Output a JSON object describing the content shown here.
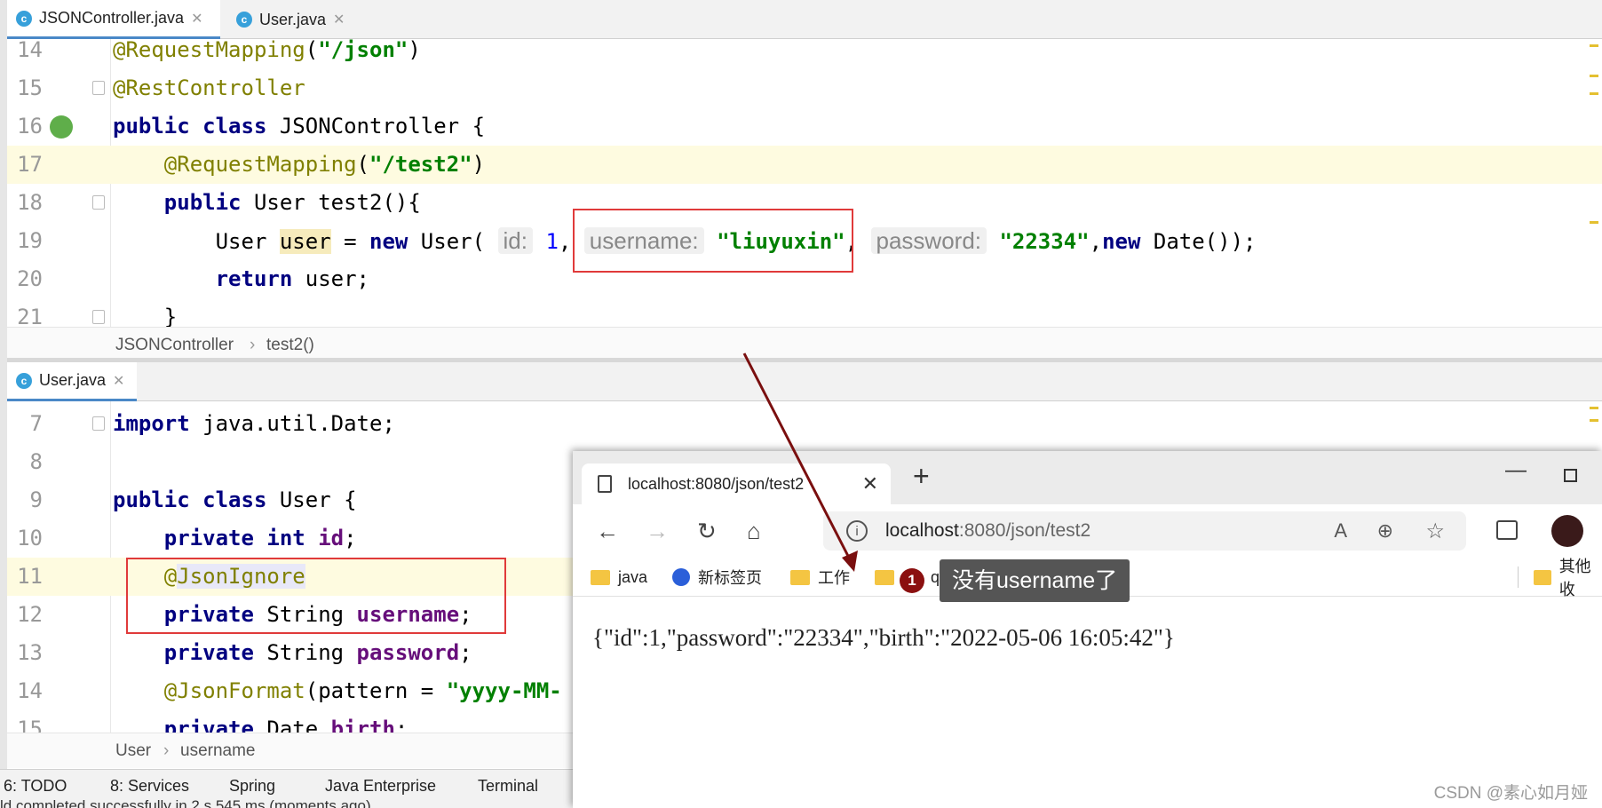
{
  "top_tabs": [
    {
      "label": "JSONController.java"
    },
    {
      "label": "User.java"
    }
  ],
  "editor_top": {
    "lines": [
      {
        "num": "14",
        "text": "@RequestMapping(\"/json\")"
      },
      {
        "num": "15",
        "text": "@RestController"
      },
      {
        "num": "16",
        "text": "public class JSONController {"
      },
      {
        "num": "17",
        "text": "    @RequestMapping(\"/test2\")"
      },
      {
        "num": "18",
        "text": "    public User test2(){"
      },
      {
        "num": "19",
        "text": "        User user = new User( id: 1, username: \"liuyuxin\", password: \"22334\",new Date());"
      },
      {
        "num": "20",
        "text": "        return user;"
      },
      {
        "num": "21",
        "text": "    }"
      }
    ],
    "breadcrumb": {
      "class": "JSONController",
      "method": "test2()"
    }
  },
  "bottom_tab": {
    "label": "User.java"
  },
  "editor_bottom": {
    "lines": [
      {
        "num": "7",
        "text": "import java.util.Date;"
      },
      {
        "num": "8",
        "text": ""
      },
      {
        "num": "9",
        "text": "public class User {"
      },
      {
        "num": "10",
        "text": "    private int id;"
      },
      {
        "num": "11",
        "text": "    @JsonIgnore"
      },
      {
        "num": "12",
        "text": "    private String username;"
      },
      {
        "num": "13",
        "text": "    private String password;"
      },
      {
        "num": "14",
        "text": "    @JsonFormat(pattern = \"yyyy-MM-"
      },
      {
        "num": "15",
        "text": "    private Date birth;"
      }
    ],
    "breadcrumb": {
      "class": "User",
      "field": "username"
    }
  },
  "tool_windows": [
    "6: TODO",
    "8: Services",
    "Spring",
    "Java Enterprise",
    "Terminal"
  ],
  "status_text": "ld completed successfully in 2 s 545 ms (moments ago)",
  "browser": {
    "tab_title": "localhost:8080/json/test2",
    "address_host": "localhost",
    "address_rest": ":8080/json/test2",
    "favorites": [
      "java",
      "新标签页",
      "工作",
      "q",
      "其他收"
    ],
    "json_response": "{\"id\":1,\"password\":\"22334\",\"birth\":\"2022-05-06 16:05:42\"}"
  },
  "annotation": {
    "badge": "1",
    "tooltip": "没有username了"
  },
  "watermark": "CSDN @素心如月娅",
  "colors": {
    "keyword": "#000080",
    "annotation": "#808000",
    "string": "#008000",
    "highlight_box": "#e03a3a"
  }
}
